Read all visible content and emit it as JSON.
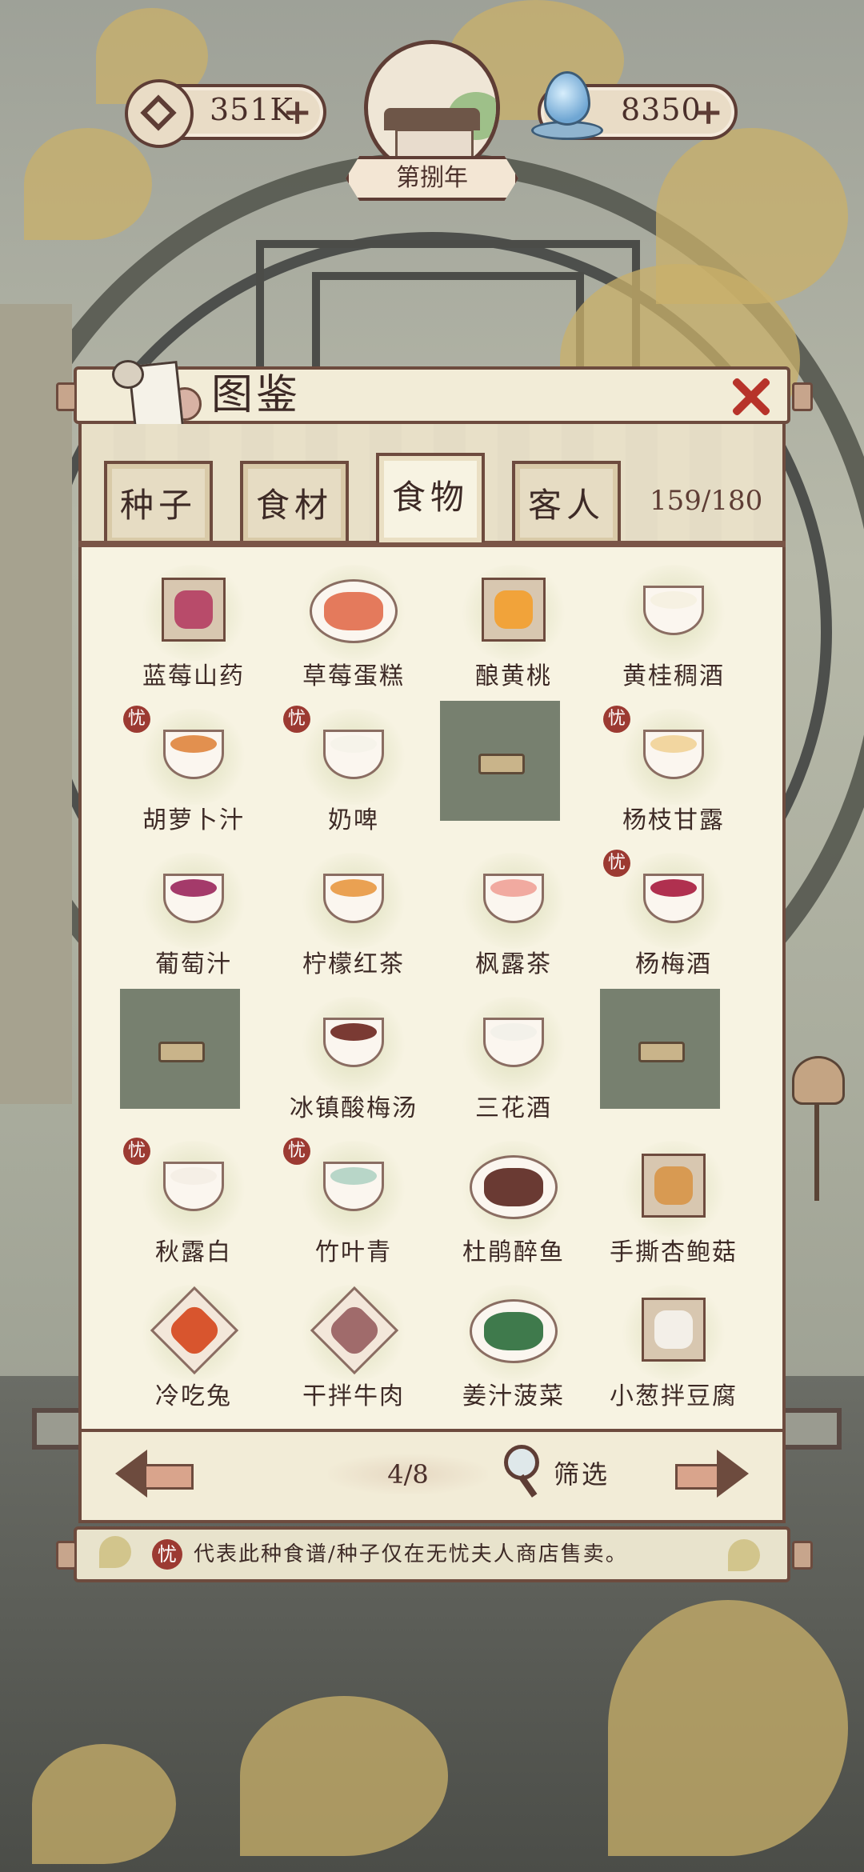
{
  "top_bar": {
    "coins": {
      "value": "351K",
      "plus": "+"
    },
    "year": {
      "label": "第捌年"
    },
    "water": {
      "value": "8350",
      "plus": "+"
    }
  },
  "panel": {
    "title": "图鉴",
    "tabs": [
      {
        "label": "种子",
        "active": false
      },
      {
        "label": "食材",
        "active": false
      },
      {
        "label": "食物",
        "active": true
      },
      {
        "label": "客人",
        "active": false
      }
    ],
    "count": "159/180",
    "seal_glyph": "忧",
    "items": [
      {
        "name": "蓝莓山药",
        "dish": "box",
        "color": "#b84b6a",
        "seal": false
      },
      {
        "name": "草莓蛋糕",
        "dish": "plate",
        "color": "#e47a5c",
        "seal": false
      },
      {
        "name": "酿黄桃",
        "dish": "box",
        "color": "#f1a33a",
        "seal": false
      },
      {
        "name": "黄桂稠酒",
        "dish": "bowl",
        "color": "#f6f1e2",
        "seal": false
      },
      {
        "name": "胡萝卜汁",
        "dish": "bowl",
        "color": "#e2904f",
        "seal": true
      },
      {
        "name": "奶啤",
        "dish": "bowl",
        "color": "#f6f3ea",
        "seal": true
      },
      {
        "name": "",
        "dish": "locked",
        "color": "",
        "seal": false
      },
      {
        "name": "杨枝甘露",
        "dish": "bowl",
        "color": "#f2d6a0",
        "seal": true
      },
      {
        "name": "葡萄汁",
        "dish": "bowl",
        "color": "#a43a6a",
        "seal": false
      },
      {
        "name": "柠檬红茶",
        "dish": "bowl",
        "color": "#eaa152",
        "seal": false
      },
      {
        "name": "枫露茶",
        "dish": "bowl",
        "color": "#f1aaa0",
        "seal": false
      },
      {
        "name": "杨梅酒",
        "dish": "bowl",
        "color": "#b0304f",
        "seal": true
      },
      {
        "name": "",
        "dish": "locked",
        "color": "",
        "seal": false
      },
      {
        "name": "冰镇酸梅汤",
        "dish": "bowl",
        "color": "#7a3a33",
        "seal": false
      },
      {
        "name": "三花酒",
        "dish": "bowl",
        "color": "#f3f1ea",
        "seal": false
      },
      {
        "name": "",
        "dish": "locked",
        "color": "",
        "seal": false
      },
      {
        "name": "秋露白",
        "dish": "bowl",
        "color": "#f5efe6",
        "seal": true
      },
      {
        "name": "竹叶青",
        "dish": "bowl",
        "color": "#b8d6c8",
        "seal": true
      },
      {
        "name": "杜鹃醉鱼",
        "dish": "plate",
        "color": "#6a3a33",
        "seal": false
      },
      {
        "name": "手撕杏鲍菇",
        "dish": "box",
        "color": "#d89a52",
        "seal": false
      },
      {
        "name": "冷吃兔",
        "dish": "diamond",
        "color": "#d8552e",
        "seal": false
      },
      {
        "name": "干拌牛肉",
        "dish": "diamond",
        "color": "#a06b6b",
        "seal": false
      },
      {
        "name": "姜汁菠菜",
        "dish": "plate",
        "color": "#3f7a4c",
        "seal": false
      },
      {
        "name": "小葱拌豆腐",
        "dish": "box",
        "color": "#f3efe8",
        "seal": false
      }
    ]
  },
  "footer": {
    "page": "4/8",
    "filter_label": "筛选"
  },
  "note": {
    "seal": "忧",
    "text": "代表此种食谱/种子仅在无忧夫人商店售卖。"
  }
}
